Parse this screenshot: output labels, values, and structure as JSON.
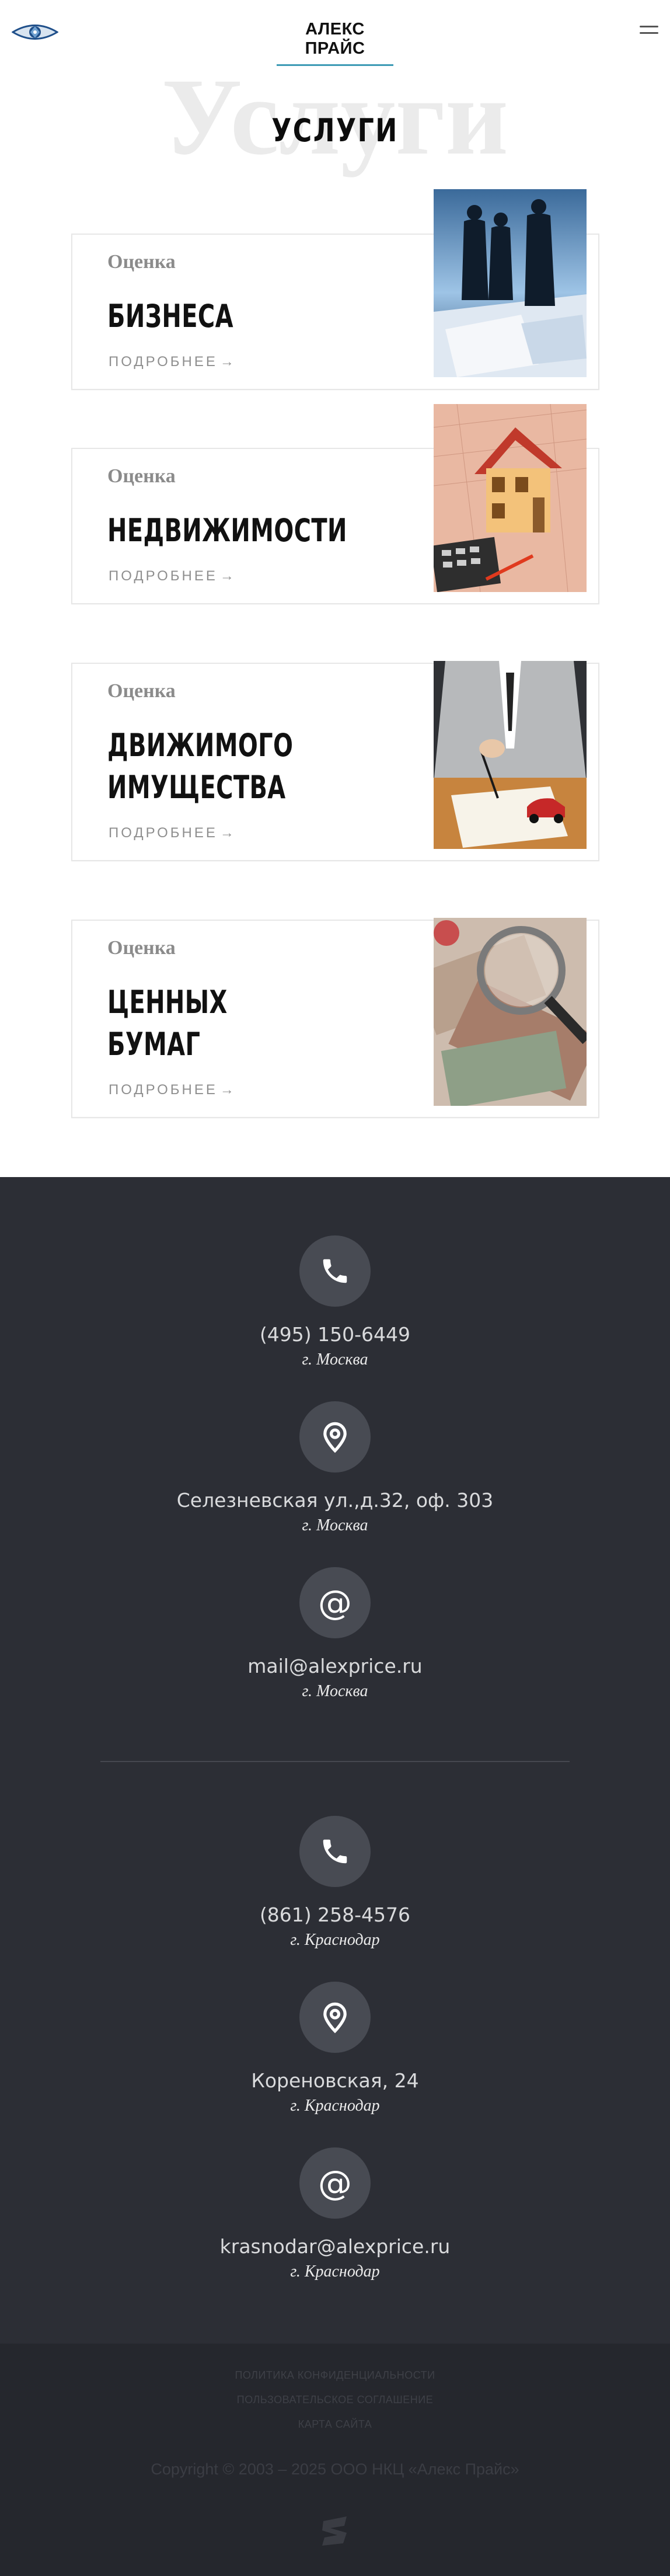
{
  "header": {
    "logo_icon": "eye-logo-icon",
    "brand": "АЛЕКС ПРАЙС",
    "menu_icon": "hamburger-menu-icon"
  },
  "hero": {
    "background_word": "Услуги",
    "title": "УСЛУГИ"
  },
  "services": [
    {
      "prefix": "Оценка",
      "title": "БИЗНЕСА",
      "more": "ПОДРОБНЕЕ",
      "image": "business-people-silhouettes-image"
    },
    {
      "prefix": "Оценка",
      "title": "НЕДВИЖИМОСТИ",
      "more": "ПОДРОБНЕЕ",
      "image": "house-model-blueprint-image"
    },
    {
      "prefix": "Оценка",
      "title": "ДВИЖИМОГО\nИМУЩЕСТВА",
      "more": "ПОДРОБНЕЕ",
      "image": "signing-document-toy-car-image"
    },
    {
      "prefix": "Оценка",
      "title": "ЦЕННЫХ\nБУМАГ",
      "more": "ПОДРОБНЕЕ",
      "image": "banknotes-magnifier-image"
    }
  ],
  "arrow_glyph": "→",
  "contacts": [
    {
      "icon": "phone-icon",
      "value": "(495) 150-6449",
      "city": "г. Москва"
    },
    {
      "icon": "location-pin-icon",
      "value": "Селезневская ул.,д.32, оф. 303",
      "city": "г. Москва"
    },
    {
      "icon": "at-sign-icon",
      "value": "mail@alexprice.ru",
      "city": "г. Москва"
    },
    {
      "icon": "phone-icon",
      "value": "(861) 258-4576",
      "city": "г. Краснодар"
    },
    {
      "icon": "location-pin-icon",
      "value": "Кореновская, 24",
      "city": "г. Краснодар"
    },
    {
      "icon": "at-sign-icon",
      "value": "krasnodar@alexprice.ru",
      "city": "г. Краснодар"
    }
  ],
  "footer": {
    "links": [
      "ПОЛИТИКА КОНФИДЕНЦИАЛЬНОСТИ",
      "ПОЛЬЗОВАТЕЛЬСКОЕ СОГЛАШЕНИЕ",
      "КАРТА САЙТА"
    ],
    "copyright": "Copyright © 2003 – 2025 ООО НКЦ «Алекс Прайс»",
    "developer_logo_icon": "developer-logo-icon"
  },
  "colors": {
    "accent": "#3d9bb5",
    "contacts_bg": "#2c2e35",
    "footer_bg": "#25272d",
    "icon_circle": "#484b53"
  }
}
